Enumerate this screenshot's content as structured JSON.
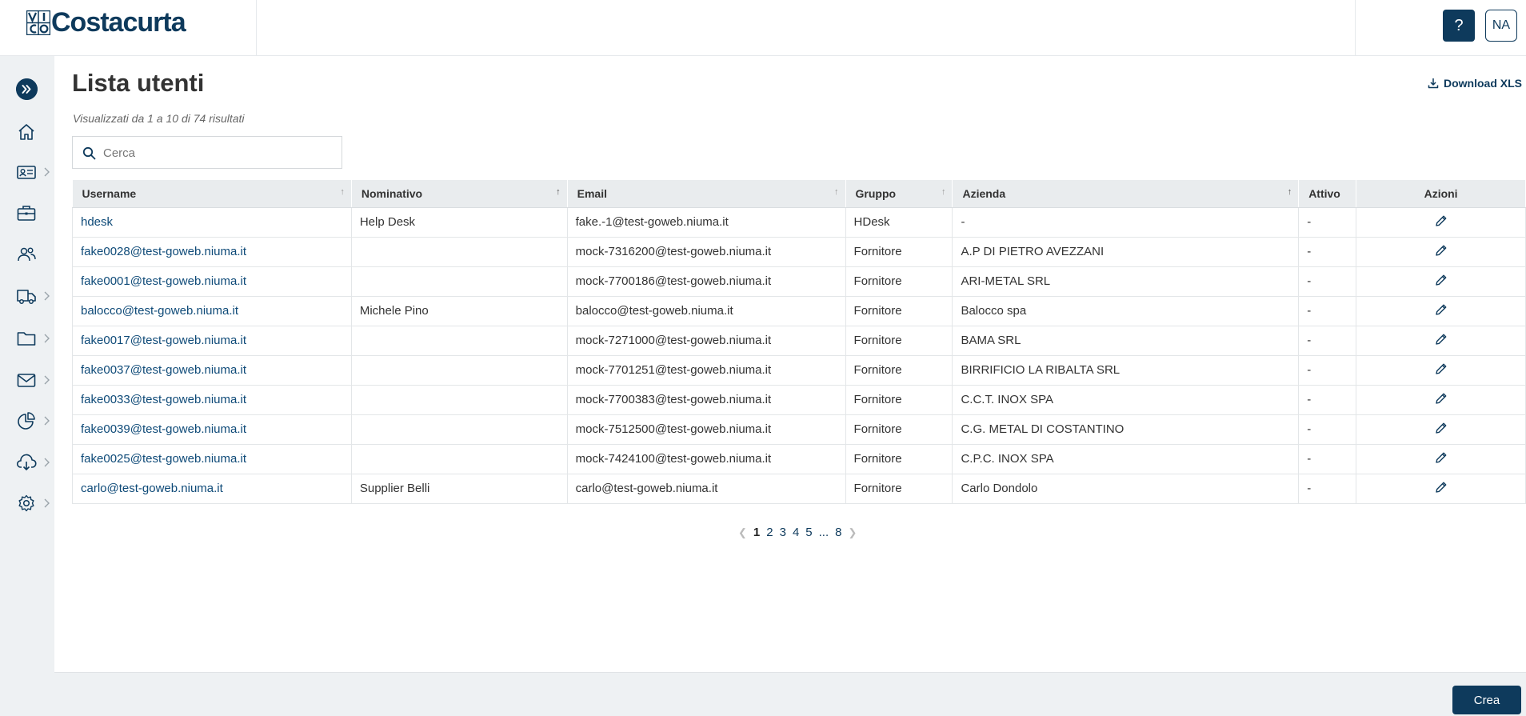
{
  "brand": {
    "name": "Costacurta",
    "mark": "VICO"
  },
  "header": {
    "help_label": "?",
    "user_initials": "NA"
  },
  "sidebar": {
    "items": [
      {
        "icon": "home-icon",
        "has_chevron": false
      },
      {
        "icon": "id-card-icon",
        "has_chevron": true
      },
      {
        "icon": "briefcase-icon",
        "has_chevron": false
      },
      {
        "icon": "users-icon",
        "has_chevron": false
      },
      {
        "icon": "truck-icon",
        "has_chevron": true
      },
      {
        "icon": "folder-icon",
        "has_chevron": true
      },
      {
        "icon": "mail-icon",
        "has_chevron": true
      },
      {
        "icon": "pie-chart-icon",
        "has_chevron": true
      },
      {
        "icon": "cloud-download-icon",
        "has_chevron": true
      },
      {
        "icon": "gear-icon",
        "has_chevron": true
      }
    ]
  },
  "page": {
    "title": "Lista utenti",
    "subtitle": "Visualizzati da 1 a 10 di 74 risultati",
    "download_label": "Download XLS",
    "search_placeholder": "Cerca"
  },
  "table": {
    "columns": [
      "Username",
      "Nominativo",
      "Email",
      "Gruppo",
      "Azienda",
      "Attivo",
      "Azioni"
    ],
    "rows": [
      {
        "username": "hdesk",
        "nominativo": "Help Desk",
        "email": "fake.-1@test-goweb.niuma.it",
        "gruppo": "HDesk",
        "azienda": "-",
        "attivo": "-"
      },
      {
        "username": "fake0028@test-goweb.niuma.it",
        "nominativo": "",
        "email": "mock-7316200@test-goweb.niuma.it",
        "gruppo": "Fornitore",
        "azienda": "A.P DI PIETRO AVEZZANI",
        "attivo": "-"
      },
      {
        "username": "fake0001@test-goweb.niuma.it",
        "nominativo": "",
        "email": "mock-7700186@test-goweb.niuma.it",
        "gruppo": "Fornitore",
        "azienda": "ARI-METAL SRL",
        "attivo": "-"
      },
      {
        "username": "balocco@test-goweb.niuma.it",
        "nominativo": "Michele Pino",
        "email": "balocco@test-goweb.niuma.it",
        "gruppo": "Fornitore",
        "azienda": "Balocco spa",
        "attivo": "-"
      },
      {
        "username": "fake0017@test-goweb.niuma.it",
        "nominativo": "",
        "email": "mock-7271000@test-goweb.niuma.it",
        "gruppo": "Fornitore",
        "azienda": "BAMA SRL",
        "attivo": "-"
      },
      {
        "username": "fake0037@test-goweb.niuma.it",
        "nominativo": "",
        "email": "mock-7701251@test-goweb.niuma.it",
        "gruppo": "Fornitore",
        "azienda": "BIRRIFICIO LA RIBALTA SRL",
        "attivo": "-"
      },
      {
        "username": "fake0033@test-goweb.niuma.it",
        "nominativo": "",
        "email": "mock-7700383@test-goweb.niuma.it",
        "gruppo": "Fornitore",
        "azienda": "C.C.T. INOX SPA",
        "attivo": "-"
      },
      {
        "username": "fake0039@test-goweb.niuma.it",
        "nominativo": "",
        "email": "mock-7512500@test-goweb.niuma.it",
        "gruppo": "Fornitore",
        "azienda": "C.G. METAL DI COSTANTINO",
        "attivo": "-"
      },
      {
        "username": "fake0025@test-goweb.niuma.it",
        "nominativo": "",
        "email": "mock-7424100@test-goweb.niuma.it",
        "gruppo": "Fornitore",
        "azienda": "C.P.C. INOX SPA",
        "attivo": "-"
      },
      {
        "username": "carlo@test-goweb.niuma.it",
        "nominativo": "Supplier Belli",
        "email": "carlo@test-goweb.niuma.it",
        "gruppo": "Fornitore",
        "azienda": "Carlo Dondolo",
        "attivo": "-"
      }
    ]
  },
  "pagination": {
    "pages": [
      "1",
      "2",
      "3",
      "4",
      "5"
    ],
    "ellipsis": "...",
    "last": "8",
    "current": "1"
  },
  "footer": {
    "create_label": "Crea"
  },
  "colors": {
    "primary": "#0e3a5c",
    "link": "#0e4a78",
    "sidebar_bg": "#eef1f3",
    "header_bg": "#e9ecee"
  }
}
